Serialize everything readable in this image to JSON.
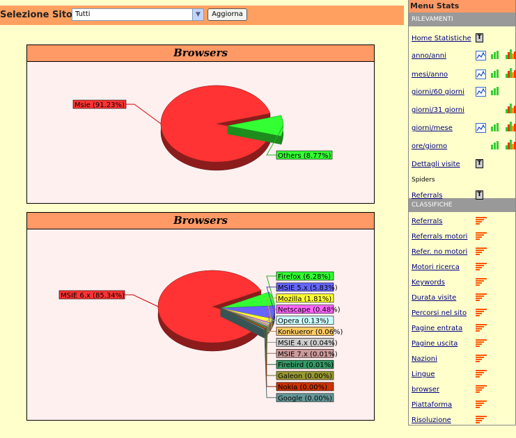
{
  "toolbar": {
    "site_label": "Selezione Sito:",
    "site_selected": "Tutti",
    "refresh_label": "Aggiorna"
  },
  "charts": [
    {
      "title": "Browsers",
      "chart_data": {
        "type": "pie",
        "title": "Browsers",
        "slices": [
          {
            "label": "Msie (91.23%)",
            "value": 91.23,
            "color": "#ff3333"
          },
          {
            "label": "Others (8.77%)",
            "value": 8.77,
            "color": "#33ff33"
          }
        ]
      }
    },
    {
      "title": "Browsers",
      "chart_data": {
        "type": "pie",
        "title": "Browsers",
        "slices": [
          {
            "label": "MSIE 6.x (85.34%)",
            "value": 85.34,
            "color": "#ff3333"
          },
          {
            "label": "Firefox (6.28%)",
            "value": 6.28,
            "color": "#33ff33"
          },
          {
            "label": "MSIE 5.x (5.83%)",
            "value": 5.83,
            "color": "#6666ff"
          },
          {
            "label": "Mozilla (1.81%)",
            "value": 1.81,
            "color": "#ffff33"
          },
          {
            "label": "Netscape (0.48%)",
            "value": 0.48,
            "color": "#ff66ff"
          },
          {
            "label": "Opera (0.13%)",
            "value": 0.13,
            "color": "#ccffff"
          },
          {
            "label": "Konkueror (0.06%)",
            "value": 0.06,
            "color": "#ffcc66"
          },
          {
            "label": "MSIE 4.x (0.04%)",
            "value": 0.04,
            "color": "#cccccc"
          },
          {
            "label": "MSIE 7.x (0.01%)",
            "value": 0.01,
            "color": "#cc9999"
          },
          {
            "label": "Firebird (0.01%)",
            "value": 0.01,
            "color": "#339966"
          },
          {
            "label": "Galeon (0.00%)",
            "value": 0.0,
            "color": "#999933"
          },
          {
            "label": "Nokia (0.00%)",
            "value": 0.0,
            "color": "#cc3300"
          },
          {
            "label": "Google (0.00%)",
            "value": 0.0,
            "color": "#669999"
          }
        ]
      }
    }
  ],
  "sidebar": {
    "title": "Menu Stats",
    "rilevamenti_label": "RILEVAMENTI",
    "rilevamenti": [
      {
        "label": "Home Statistiche",
        "icons": [
          "t-icon"
        ]
      },
      {
        "label": "anno/anni",
        "icons": [
          "line-chart-icon",
          "bar-chart-icon",
          "multi-bar-chart-icon"
        ]
      },
      {
        "label": "mesi/anno",
        "icons": [
          "line-chart-icon",
          "bar-chart-icon",
          "multi-bar-chart-icon"
        ]
      },
      {
        "label": "giorni/60 giorni",
        "icons": [
          "line-chart-icon",
          "bar-chart-icon"
        ]
      },
      {
        "label": "giorni/31 giorni",
        "icons": [
          "multi-bar-chart-icon"
        ]
      },
      {
        "label": "giorni/mese",
        "icons": [
          "line-chart-icon",
          "bar-chart-icon",
          "multi-bar-chart-icon"
        ]
      },
      {
        "label": "ore/giorno",
        "icons": [
          "bar-chart-icon",
          "multi-bar-chart-icon"
        ]
      },
      {
        "label": "Dettagli visite",
        "icons": [
          "t-icon"
        ]
      },
      {
        "label": "Spiders",
        "icons": []
      },
      {
        "label": "Referrals",
        "icons": [
          "t-icon"
        ]
      }
    ],
    "classifiche_label": "CLASSIFICHE",
    "classifiche": [
      "Referrals",
      "Referrals motori",
      "Refer. no motori",
      "Motori ricerca",
      "Keywords",
      "Durata visite",
      "Percorsi nel sito",
      "Pagine entrata",
      "Pagine uscita",
      "Nazioni",
      "Lingue",
      "browser",
      "Piattaforma",
      "Risoluzione"
    ]
  }
}
